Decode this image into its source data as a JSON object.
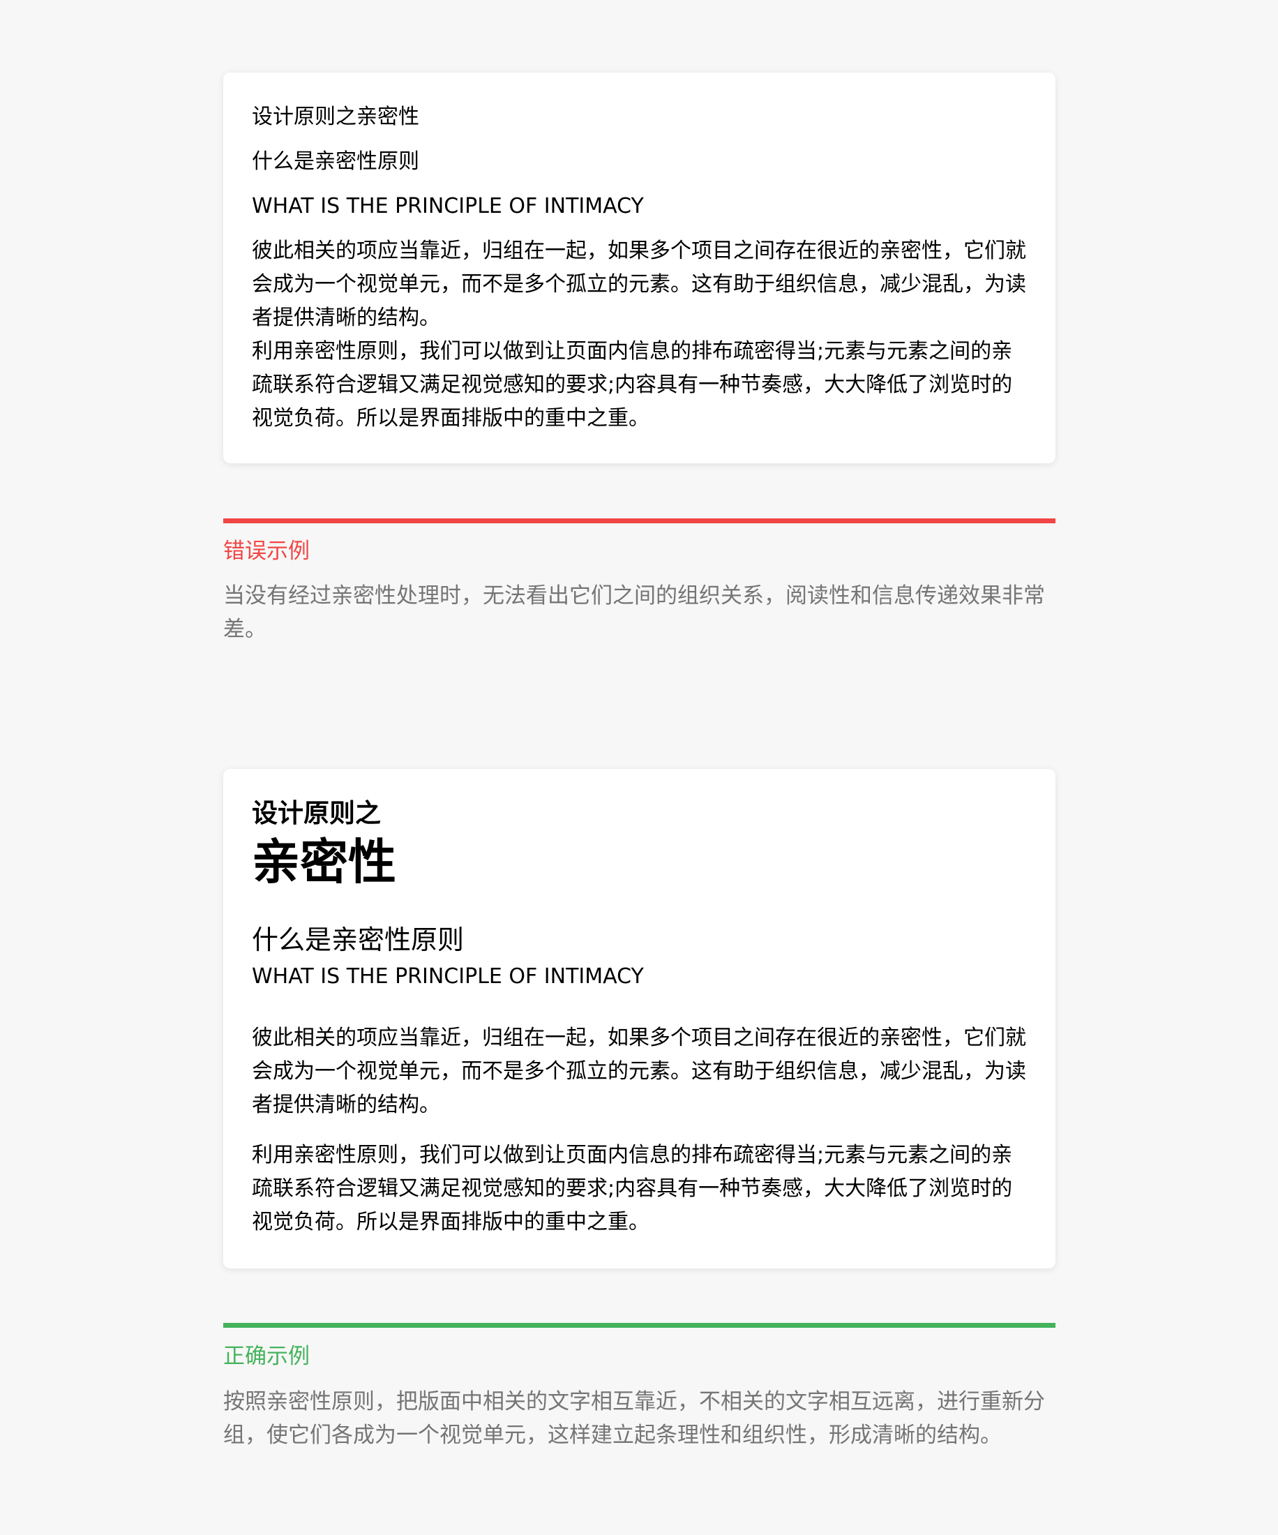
{
  "colors": {
    "error": "#f24545",
    "correct": "#44b35c",
    "muted_text": "#757575",
    "background": "#f7f7f7"
  },
  "bad_example": {
    "title": "设计原则之亲密性",
    "subtitle": "什么是亲密性原则",
    "subtitle_en": "WHAT IS THE PRINCIPLE OF INTIMACY",
    "paragraph_1": "彼此相关的项应当靠近，归组在一起，如果多个项目之间存在很近的亲密性，它们就会成为一个视觉单元，而不是多个孤立的元素。这有助于组织信息，减少混乱，为读者提供清晰的结构。",
    "paragraph_2": "利用亲密性原则，我们可以做到让页面内信息的排布疏密得当;元素与元素之间的亲疏联系符合逻辑又满足视觉感知的要求;内容具有一种节奏感，大大降低了浏览时的视觉负荷。所以是界面排版中的重中之重。",
    "label": "错误示例",
    "explanation": "当没有经过亲密性处理时，无法看出它们之间的组织关系，阅读性和信息传递效果非常差。"
  },
  "good_example": {
    "title_small": "设计原则之",
    "title_big": "亲密性",
    "subtitle": "什么是亲密性原则",
    "subtitle_en": "WHAT IS THE PRINCIPLE OF INTIMACY",
    "paragraph_1": "彼此相关的项应当靠近，归组在一起，如果多个项目之间存在很近的亲密性，它们就会成为一个视觉单元，而不是多个孤立的元素。这有助于组织信息，减少混乱，为读者提供清晰的结构。",
    "paragraph_2": "利用亲密性原则，我们可以做到让页面内信息的排布疏密得当;元素与元素之间的亲疏联系符合逻辑又满足视觉感知的要求;内容具有一种节奏感，大大降低了浏览时的视觉负荷。所以是界面排版中的重中之重。",
    "label": "正确示例",
    "explanation": "按照亲密性原则，把版面中相关的文字相互靠近，不相关的文字相互远离，进行重新分组，使它们各成为一个视觉单元，这样建立起条理性和组织性，形成清晰的结构。"
  }
}
